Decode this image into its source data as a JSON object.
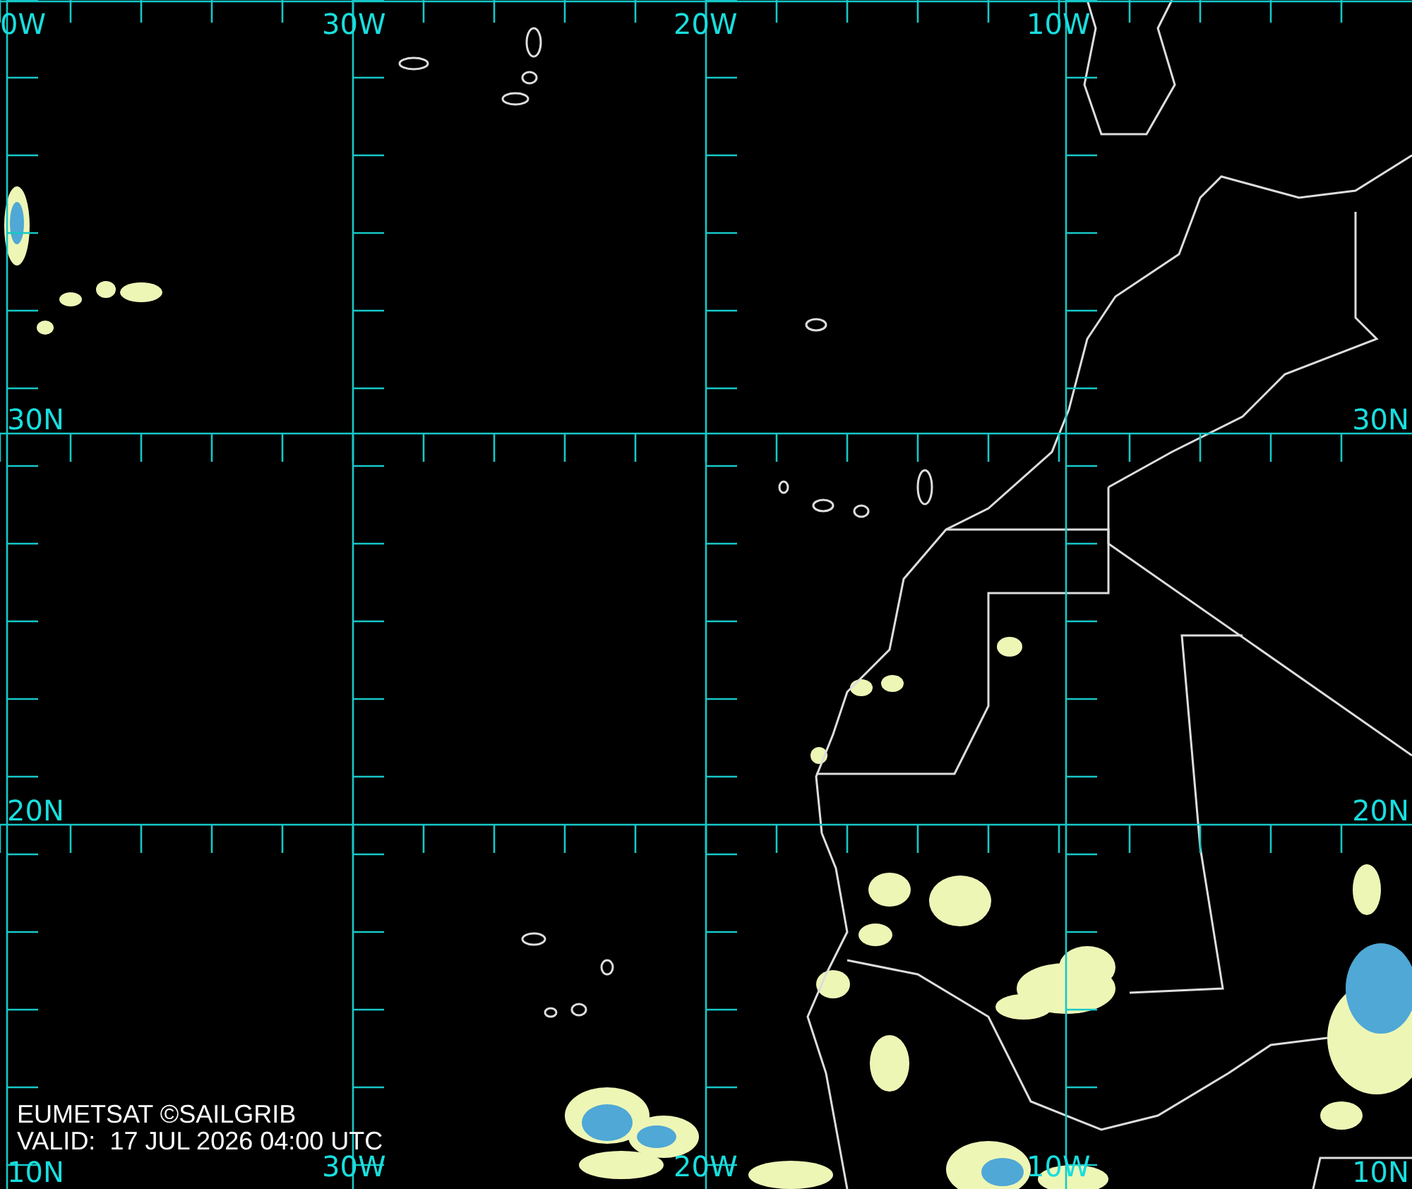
{
  "map": {
    "longitude_labels_top": [
      "0W",
      "30W",
      "20W",
      "10W"
    ],
    "longitude_labels_bottom": [
      "30W",
      "20W",
      "10W"
    ],
    "latitude_labels_left": [
      "30N",
      "20N",
      "10N"
    ],
    "latitude_labels_right": [
      "30N",
      "20N",
      "10N"
    ],
    "credit": "EUMETSAT ©SAILGRIB",
    "valid_time": "VALID:  17 JUL 2026 04:00 UTC"
  }
}
